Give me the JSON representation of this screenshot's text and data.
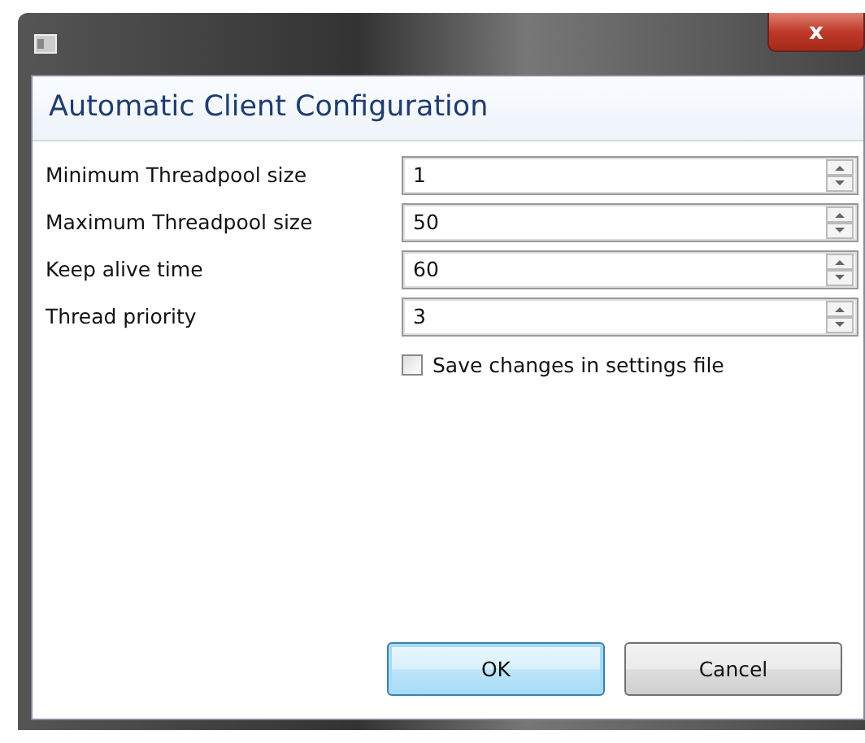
{
  "window": {
    "title_bar_close": "x"
  },
  "header": "Automatic Client Configuration",
  "fields": [
    {
      "label": "Minimum Threadpool size",
      "value": "1"
    },
    {
      "label": "Maximum Threadpool size",
      "value": "50"
    },
    {
      "label": "Keep alive time",
      "value": "60"
    },
    {
      "label": "Thread priority",
      "value": "3"
    }
  ],
  "save_checkbox": {
    "label": "Save changes in settings file",
    "checked": false
  },
  "buttons": [
    {
      "label": "OK",
      "default": true
    },
    {
      "label": "Cancel",
      "default": false
    }
  ]
}
